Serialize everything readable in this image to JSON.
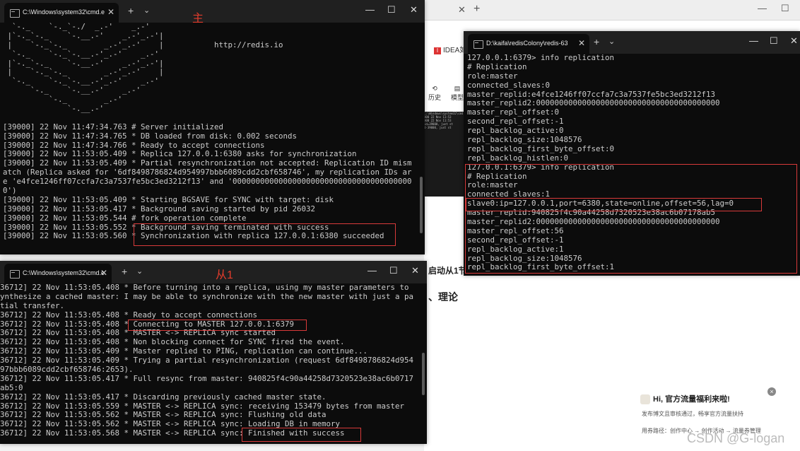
{
  "background_browser": {
    "tab_close": "✕",
    "tab_plus": "+",
    "idea_tab_label": "IDEA如",
    "side_items": [
      {
        "label": "历史"
      },
      {
        "label": "模型"
      }
    ],
    "thumb_lines": [
      "C:\\Windows\\system32\\cmd",
      "000 22 Nov 11:53",
      "000 22 Nov 11:53",
      "id=39000, just st",
      "d-39000, just st",
      "",
      "",
      "",
      ""
    ],
    "page_text1": "启动从1节点",
    "page_text2": "、理论",
    "promo": {
      "title": "Hi, 官方流量福利来啦!",
      "line1": "发布博文且审核通过，畅享官方流量扶持",
      "line2": "用券路径：创作中心 → 创作活动 → 流量券管理",
      "close": "×"
    },
    "watermark": "CSDN @G-logan"
  },
  "master_window": {
    "title": "C:\\Windows\\system32\\cmd.e",
    "annotation": "主",
    "lines": [
      "  `-._    `-._`-./  _.-'    _.-'",
      " |`-._`-._    `-.__.-'    _.-'_.-'|",
      " |    `-._`-._        _.-'_.-'    |           http://redis.io",
      "  `-._    `-._`-.__.-'_.-'    _.-'",
      " |`-._`-._    `-.__.-'    _.-'_.-'|",
      " |    `-._`-._        _.-'_.-'    |",
      "  `-._    `-._`-.__.-'_.-'    _.-'",
      "      `-._    `-.__.-'    _.-'",
      "          `-._        _.-'",
      "              `-.__.-'",
      "",
      "[39000] 22 Nov 11:47:34.763 # Server initialized",
      "[39000] 22 Nov 11:47:34.765 * DB loaded from disk: 0.002 seconds",
      "[39000] 22 Nov 11:47:34.766 * Ready to accept connections",
      "[39000] 22 Nov 11:53:05.409 * Replica 127.0.0.1:6380 asks for synchronization",
      "[39000] 22 Nov 11:53:05.409 * Partial resynchronization not accepted: Replication ID mism",
      "atch (Replica asked for '6df8498786824d954997bbb6089cdd2cbf658746', my replication IDs ar",
      "e 'e4fce1246ff07ccfa7c3a7537fe5bc3ed3212f13' and '000000000000000000000000000000000000000",
      "0')",
      "[39000] 22 Nov 11:53:05.409 * Starting BGSAVE for SYNC with target: disk",
      "[39000] 22 Nov 11:53:05.417 * Background saving started by pid 26032",
      "[39000] 22 Nov 11:53:05.544 # fork operation complete",
      "[39000] 22 Nov 11:53:05.552 * Background saving terminated with success",
      "[39000] 22 Nov 11:53:05.560 * Synchronization with replica 127.0.0.1:6380 succeeded"
    ]
  },
  "slave_window": {
    "title": "C:\\Windows\\system32\\cmd.e",
    "annotation": "从1",
    "lines": [
      "36712] 22 Nov 11:53:05.408 * Before turning into a replica, using my master parameters to",
      "ynthesize a cached master: I may be able to synchronize with the new master with just a pa",
      "tial transfer.",
      "36712] 22 Nov 11:53:05.408 * Ready to accept connections",
      "36712] 22 Nov 11:53:05.408 * Connecting to MASTER 127.0.0.1:6379",
      "36712] 22 Nov 11:53:05.408 * MASTER <-> REPLICA sync started",
      "36712] 22 Nov 11:53:05.408 * Non blocking connect for SYNC fired the event.",
      "36712] 22 Nov 11:53:05.409 * Master replied to PING, replication can continue...",
      "36712] 22 Nov 11:53:05.409 * Trying a partial resynchronization (request 6df8498786824d954",
      "97bbb6089cdd2cbf658746:2653).",
      "36712] 22 Nov 11:53:05.417 * Full resync from master: 940825f4c90a44258d7320523e38ac6b0717",
      "ab5:0",
      "36712] 22 Nov 11:53:05.417 * Discarding previously cached master state.",
      "36712] 22 Nov 11:53:05.559 * MASTER <-> REPLICA sync: receiving 153479 bytes from master",
      "36712] 22 Nov 11:53:05.562 * MASTER <-> REPLICA sync: Flushing old data",
      "36712] 22 Nov 11:53:05.562 * MASTER <-> REPLICA sync: Loading DB in memory",
      "36712] 22 Nov 11:53:05.568 * MASTER <-> REPLICA sync: Finished with success"
    ]
  },
  "cli_window": {
    "title": "D:\\kaifa\\redisColony\\redis-63",
    "lines": [
      "127.0.0.1:6379> info replication",
      "# Replication",
      "role:master",
      "connected_slaves:0",
      "master_replid:e4fce1246ff07ccfa7c3a7537fe5bc3ed3212f13",
      "master_replid2:0000000000000000000000000000000000000000",
      "master_repl_offset:0",
      "second_repl_offset:-1",
      "repl_backlog_active:0",
      "repl_backlog_size:1048576",
      "repl_backlog_first_byte_offset:0",
      "repl_backlog_histlen:0",
      "127.0.0.1:6379> info replication",
      "# Replication",
      "role:master",
      "connected_slaves:1",
      "slave0:ip=127.0.0.1,port=6380,state=online,offset=56,lag=0",
      "master_replid:940825f4c90a44258d7320523e38ac6b07178ab5",
      "master_replid2:0000000000000000000000000000000000000000",
      "master_repl_offset:56",
      "second_repl_offset:-1",
      "repl_backlog_active:1",
      "repl_backlog_size:1048576",
      "repl_backlog_first_byte_offset:1"
    ]
  },
  "window_controls": {
    "minimize": "—",
    "maximize": "☐",
    "close": "✕",
    "plus": "+",
    "dropdown": "⌄",
    "tab_close": "✕"
  },
  "colors": {
    "terminal_bg": "#0c0c0c",
    "terminal_text": "#cccccc",
    "highlight": "#d83a3a",
    "annotation": "#e23c2c"
  }
}
